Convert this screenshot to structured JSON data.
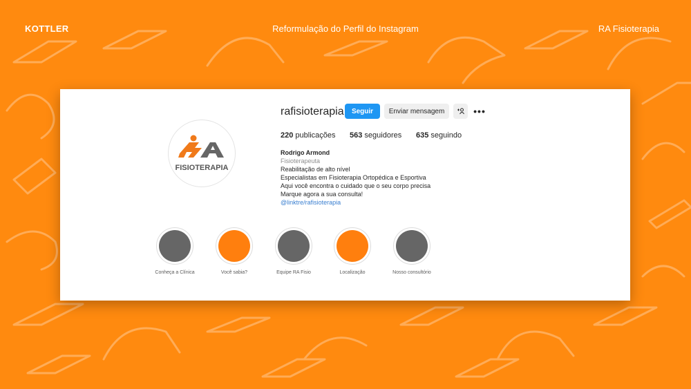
{
  "header": {
    "brand": "KOTTLER",
    "subtitle": "Reformulação do Perfil do Instagram",
    "client": "RA Fisioterapia"
  },
  "profile": {
    "username": "rafisioterapia",
    "logo_text": "FISIOTERAPIA",
    "buttons": {
      "follow": "Seguir",
      "message": "Enviar mensagem",
      "add_user_icon": "add-user-icon",
      "more_icon": "more-options-icon"
    },
    "stats": {
      "posts_count": "220",
      "posts_label": "publicações",
      "followers_count": "563",
      "followers_label": "seguidores",
      "following_count": "635",
      "following_label": "seguindo"
    },
    "bio": {
      "name": "Rodrigo Armond",
      "category": "Fisioterapeuta",
      "lines": [
        "Reabilitação de alto nível",
        "Especialistas em Fisioterapia Ortopédica e Esportiva",
        "Aqui você encontra o cuidado que o seu corpo precisa",
        "Marque agora a sua consulta!"
      ],
      "link": "@linktre/rafisioterapia"
    }
  },
  "highlights": [
    {
      "label": "Conheça a Clínica",
      "color": "#666666"
    },
    {
      "label": "Você sabia?",
      "color": "#FF7F0E"
    },
    {
      "label": "Equipe RA Fisio",
      "color": "#666666"
    },
    {
      "label": "Localização",
      "color": "#FF7F0E"
    },
    {
      "label": "Nosso consultório",
      "color": "#666666"
    }
  ],
  "colors": {
    "background": "#FF8A0F",
    "follow_button": "#1E96F3",
    "logo_orange": "#F07A1A",
    "logo_gray": "#666666"
  }
}
